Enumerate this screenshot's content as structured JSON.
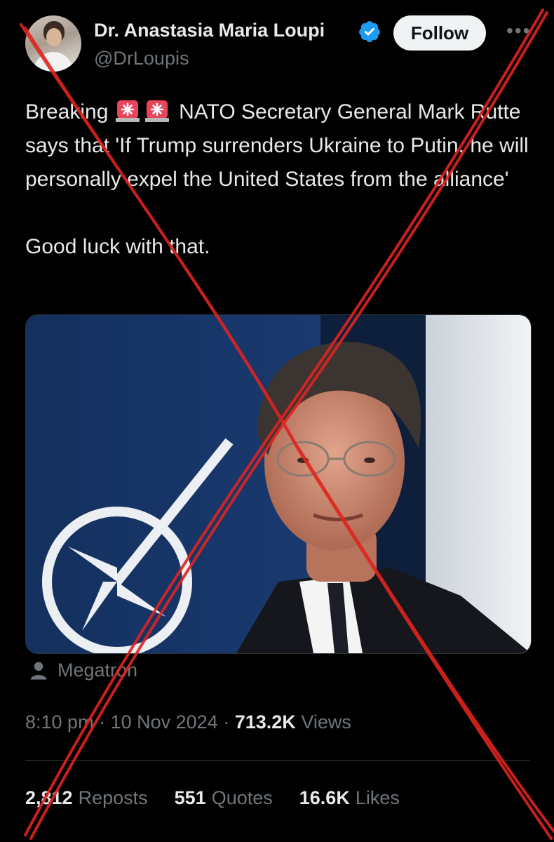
{
  "author": {
    "display_name": "Dr. Anastasia Maria Loupi",
    "handle": "@DrLoupis",
    "verified": true,
    "verified_color": "#1d9bf0"
  },
  "header": {
    "follow_label": "Follow",
    "more_icon": "ellipsis-icon"
  },
  "tweet": {
    "prefix": "Breaking",
    "emoji": "police-siren-icon",
    "line1_rest": "NATO Secretary General Mark Rutte says that 'If Trump surrenders Ukraine to Putin, he will personally expel the United States from the alliance'",
    "line2": "Good luck with that."
  },
  "media": {
    "attribution": "Megatron",
    "attribution_icon": "person-icon"
  },
  "meta": {
    "time": "8:10 pm",
    "date": "10 Nov 2024",
    "views_count": "713.2K",
    "views_label": "Views"
  },
  "stats": {
    "reposts_count": "2,812",
    "reposts_label": "Reposts",
    "quotes_count": "551",
    "quotes_label": "Quotes",
    "likes_count": "16.6K",
    "likes_label": "Likes"
  },
  "overlay": {
    "cross_color": "#e0241f"
  },
  "colors": {
    "background": "#000000",
    "text": "#e7e9ea",
    "secondary": "#71767b"
  }
}
